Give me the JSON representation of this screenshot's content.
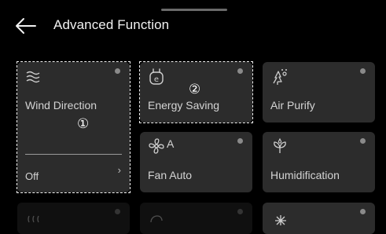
{
  "header": {
    "title": "Advanced Function",
    "back_icon": "arrow-left-icon"
  },
  "cards": {
    "wind": {
      "label": "Wind Direction",
      "value": "Off",
      "icon": "wind-lines-icon"
    },
    "energy": {
      "label": "Energy Saving",
      "icon": "plug-e-icon"
    },
    "purify": {
      "label": "Air Purify",
      "icon": "purify-icon"
    },
    "fan": {
      "label": "Fan Auto",
      "icon_text": "A",
      "icon": "fan-icon"
    },
    "humid": {
      "label": "Humidification",
      "icon": "humidifier-icon"
    }
  },
  "markers": {
    "one": "①",
    "two": "②"
  },
  "colors": {
    "background": "#000000",
    "card": "#2c2c2c",
    "dot": "#8a8a8a"
  }
}
